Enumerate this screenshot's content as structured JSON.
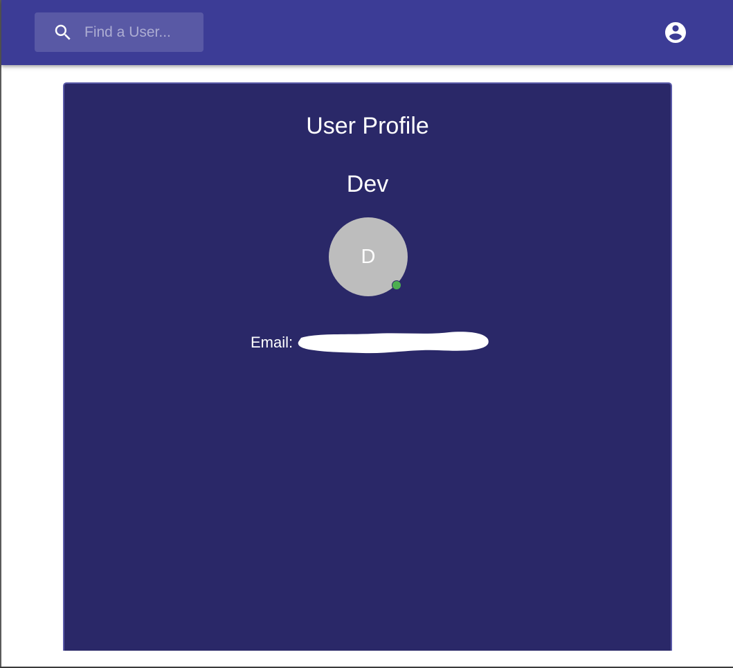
{
  "appbar": {
    "search": {
      "placeholder": "Find a User...",
      "icon": "search-icon"
    },
    "account_icon": "account-circle-icon",
    "color": "#3c3c96"
  },
  "profile_card": {
    "title": "User Profile",
    "name": "Dev",
    "avatar": {
      "initial": "D",
      "color": "#bdbdbd",
      "status_color": "#4caf50"
    },
    "email_label": "Email:",
    "email_value_redacted": true,
    "background_color": "#2a2868"
  }
}
